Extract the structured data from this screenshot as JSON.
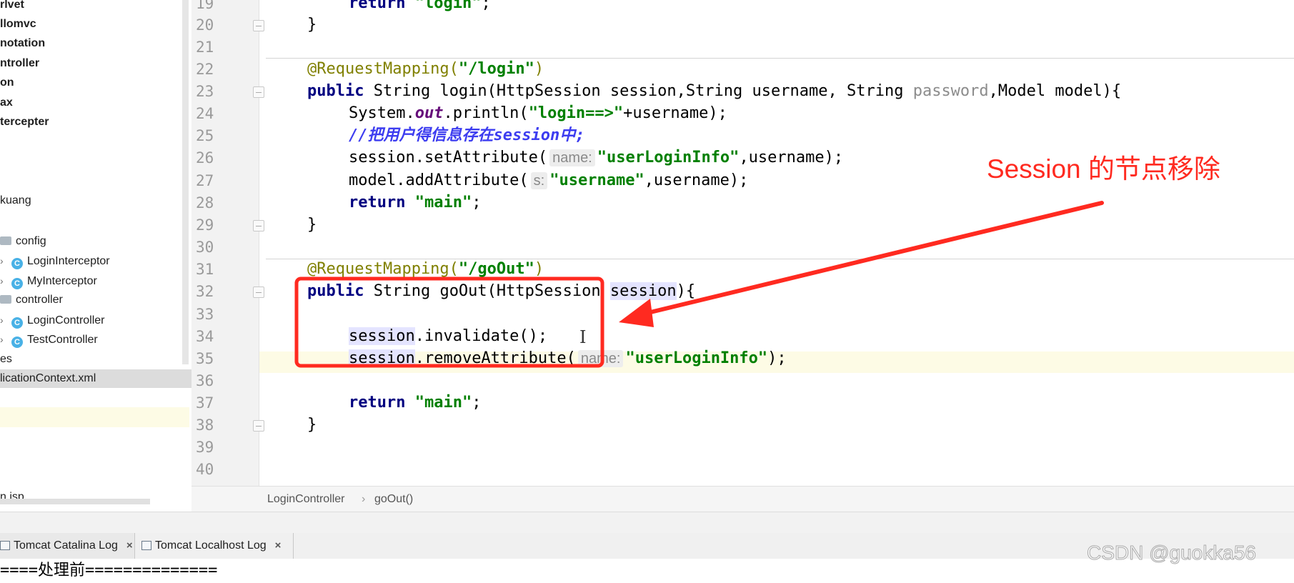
{
  "sidebar": {
    "items": [
      {
        "label": "rlvet"
      },
      {
        "label": "llomvc"
      },
      {
        "label": "notation"
      },
      {
        "label": "ntroller"
      },
      {
        "label": "on"
      },
      {
        "label": "ax"
      },
      {
        "label": "tercepter"
      },
      {
        "label": "kuang"
      },
      {
        "label": "config"
      },
      {
        "label": "LoginInterceptor",
        "icon": "class-icon"
      },
      {
        "label": "MyInterceptor",
        "icon": "class-icon"
      },
      {
        "label": "controller"
      },
      {
        "label": "LoginController",
        "icon": "class-icon"
      },
      {
        "label": "TestController",
        "icon": "class-icon"
      },
      {
        "label": "es"
      },
      {
        "label": "licationContext.xml"
      },
      {
        "label": "n.jsp"
      }
    ],
    "class_badge": "C"
  },
  "editor": {
    "line_numbers": [
      "19",
      "20",
      "21",
      "22",
      "23",
      "24",
      "25",
      "26",
      "27",
      "28",
      "29",
      "30",
      "31",
      "32",
      "33",
      "34",
      "35",
      "36",
      "37",
      "38",
      "39",
      "40"
    ],
    "code": {
      "l19_return": "return",
      "l19_str": "\"login\"",
      "l19_end": ";",
      "brace_close": "}",
      "l22_ann": "@RequestMapping(",
      "l22_str": "\"/login\"",
      "l22_end": ")",
      "l23_public": "public",
      "l23_a": " String login(HttpSession session,String username, String ",
      "l23_password": "password",
      "l23_b": ",Model model){",
      "l24_a": "System.",
      "l24_out": "out",
      "l24_b": ".println(",
      "l24_str": "\"login==>\"",
      "l24_c": "+username);",
      "l25_comment": "//把用户得信息存在session中;",
      "l26_a": "session.setAttribute(",
      "l26_hint": "name:",
      "l26_str": "\"userLoginInfo\"",
      "l26_b": ",username);",
      "l27_a": "model.addAttribute(",
      "l27_hint": "s:",
      "l27_str": "\"username\"",
      "l27_b": ",username);",
      "return_kw": "return",
      "main_str": "\"main\"",
      "semicolon": ";",
      "l31_ann": "@RequestMapping(",
      "l31_str": "\"/goOut\"",
      "l31_end": ")",
      "l32_public": "public",
      "l32_a": " String goOut(HttpSession ",
      "l32_session": "session",
      "l32_b": "){",
      "l34_session": "session",
      "l34_b": ".invalidate();",
      "l35_session": "session",
      "l35_b": ".removeAttribute(",
      "l35_hint": "name:",
      "l35_str": "\"userLoginInfo\"",
      "l35_c": ");",
      "ibeam": "I"
    }
  },
  "breadcrumb": {
    "class_name": "LoginController",
    "separator": "›",
    "method_name": "goOut()"
  },
  "bottom_tabs": [
    {
      "label": "Tomcat Catalina Log",
      "close": "×"
    },
    {
      "label": "Tomcat Localhost Log",
      "close": "×"
    }
  ],
  "console": {
    "line": "====处理前=============="
  },
  "annotation": {
    "callout": "Session 的节点移除",
    "color": "#ff2a20"
  },
  "watermark": "CSDN @guokka56"
}
